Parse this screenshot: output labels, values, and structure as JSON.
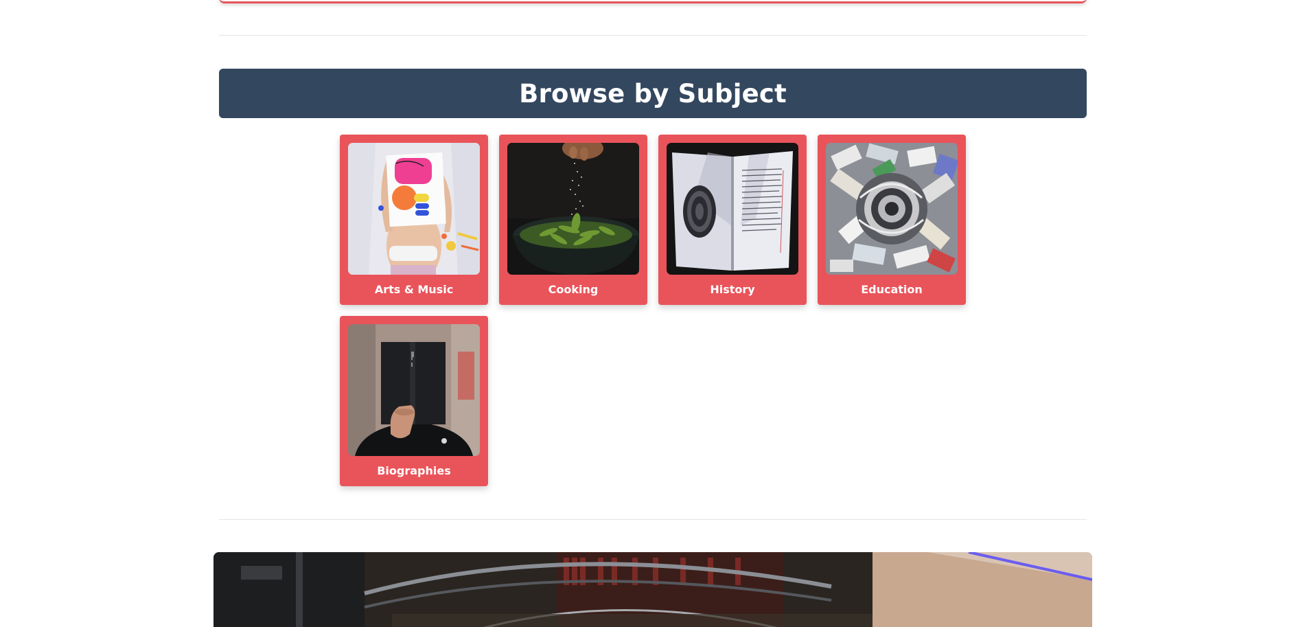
{
  "section": {
    "title": "Browse by Subject"
  },
  "subjects": [
    {
      "label": "Arts & Music",
      "image": "arts-music-photo"
    },
    {
      "label": "Cooking",
      "image": "cooking-photo"
    },
    {
      "label": "History",
      "image": "history-photo"
    },
    {
      "label": "Education",
      "image": "education-photo"
    },
    {
      "label": "Biographies",
      "image": "biographies-photo"
    }
  ],
  "colors": {
    "header_bg": "#33475f",
    "tile_bg": "#e9545a",
    "divider": "#e4e4e4"
  },
  "banner": {
    "image": "library-interior-photo"
  }
}
